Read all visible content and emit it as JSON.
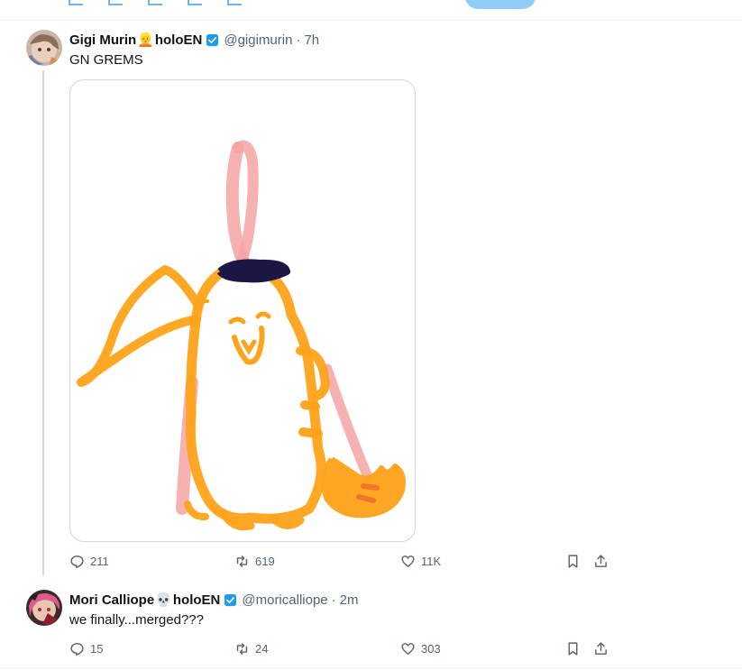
{
  "tweet1": {
    "display_name": "Gigi Murin",
    "name_emoji": "👱",
    "name_suffix": "holoEN",
    "handle": "@gigimurin",
    "separator": "·",
    "time": "7h",
    "text": "GN GREMS",
    "replies": "211",
    "retweets": "619",
    "likes": "11K"
  },
  "tweet2": {
    "display_name": "Mori Calliope",
    "name_emoji": "💀",
    "name_suffix": "holoEN",
    "handle": "@moricalliope",
    "separator": "·",
    "time": "2m",
    "text": "we finally...merged???",
    "replies": "15",
    "retweets": "24",
    "likes": "303"
  },
  "icons": {
    "reply": "reply-icon",
    "retweet": "retweet-icon",
    "like": "heart-icon",
    "bookmark": "bookmark-icon",
    "share": "share-icon",
    "verified": "verified-badge-icon"
  },
  "colors": {
    "verified_blue": "#1d9bf0",
    "muted_text": "#536471",
    "drawing_orange": "#ffa31a",
    "drawing_pink": "#f5a0a0",
    "drawing_navy": "#1c1645"
  }
}
